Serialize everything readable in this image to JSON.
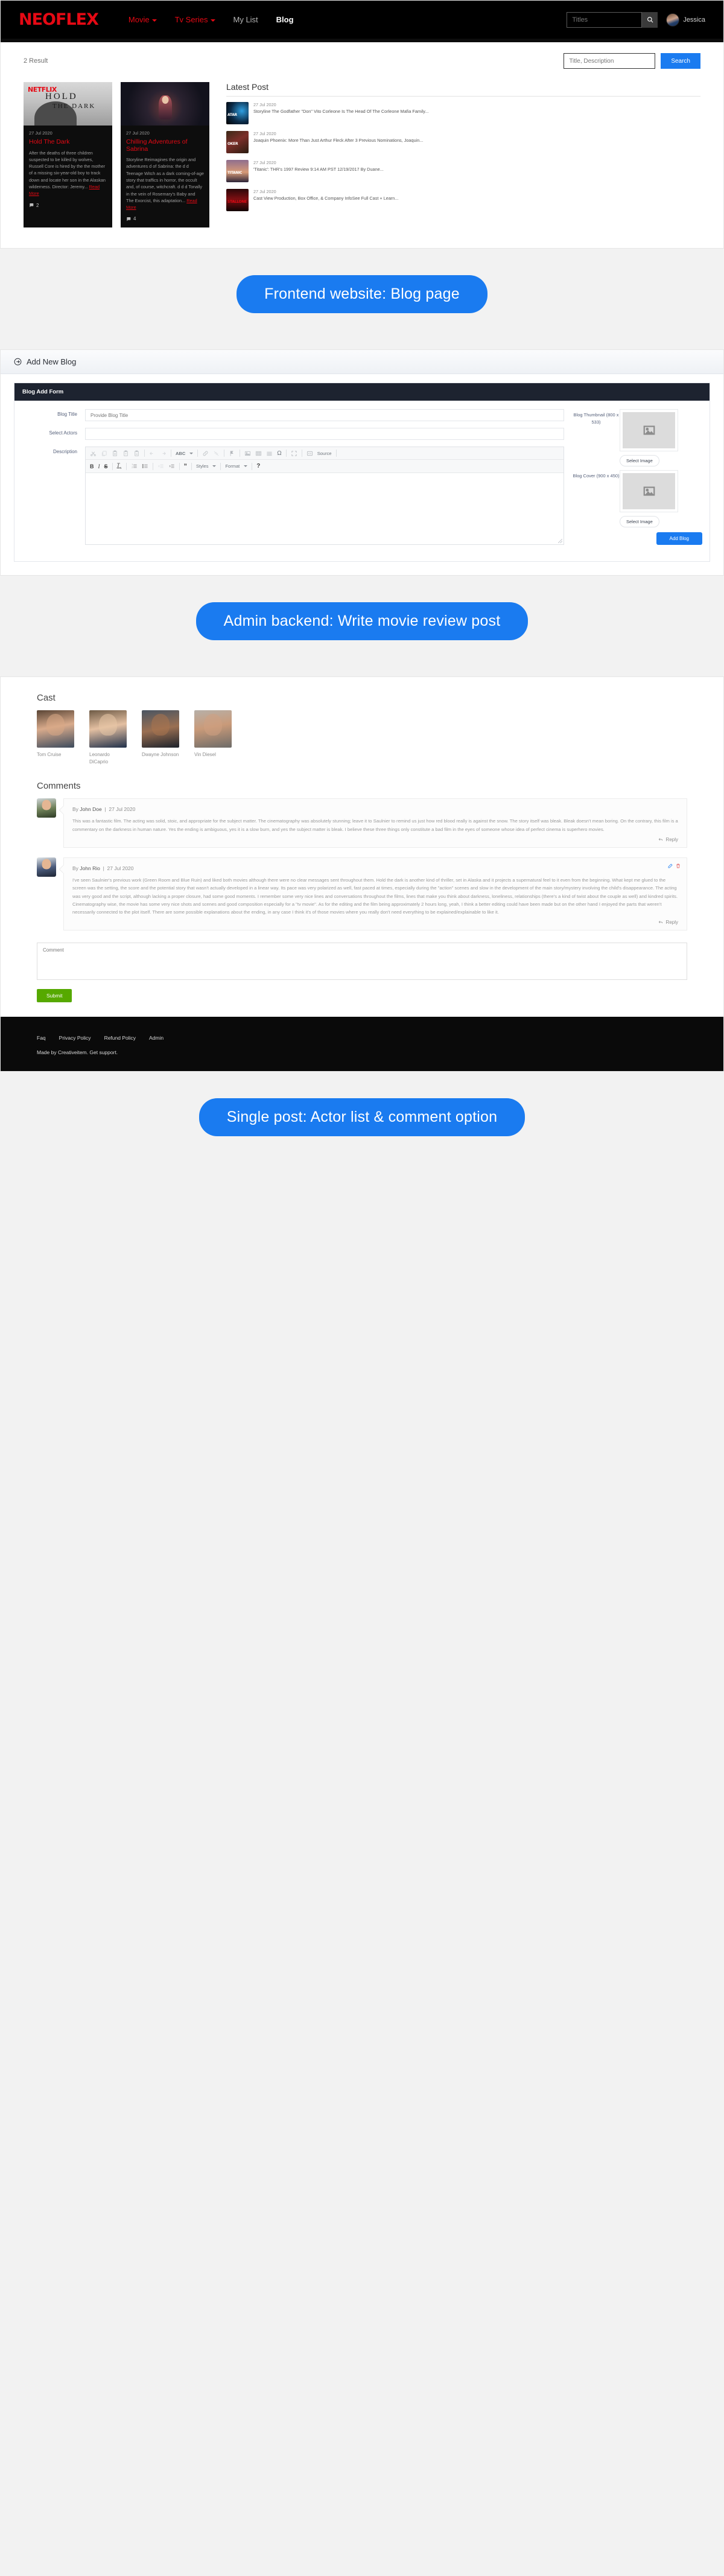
{
  "site": {
    "brand": "NEOFLEX",
    "nav": [
      {
        "label": "Movie",
        "style": "red",
        "caret": true
      },
      {
        "label": "Tv Series",
        "style": "red",
        "caret": true
      },
      {
        "label": "My List",
        "style": "muted",
        "caret": false
      },
      {
        "label": "Blog",
        "style": "active",
        "caret": false
      }
    ],
    "search_placeholder": "Titles",
    "search_icon": "search-icon",
    "user_name": "Jessica"
  },
  "blog": {
    "result_count": "2 Result",
    "filter_placeholder": "Title, Description",
    "search_button": "Search",
    "cards": [
      {
        "date": "27 Jul 2020",
        "title": "Hold The Dark",
        "excerpt": "After the deaths of three children suspected to be killed by wolves, Russell Core is hired by the the mother of a missing six-year-old boy to track down and locate her son in the Alaskan wilderness. Director:  Jeremy...",
        "read_more": "Read More",
        "comments": "2",
        "banner_logo": "NETFLIX",
        "banner_title": "HOLD",
        "banner_subtitle": "THE DARK"
      },
      {
        "date": "27 Jul 2020",
        "title": "Chilling Adventures of Sabrina",
        "excerpt": "Storyline Reimagines the origin and adventures d of Sabrina: the d d Teenage Witch as a dark coming-of-age story that traffics in horror, the occult and, of course, witchcraft. d d d Tonally in the vein of Rosemary's Baby and The Exorcist, this adaptation...",
        "read_more": "Read More",
        "comments": "4"
      }
    ],
    "latest_title": "Latest Post",
    "latest_posts": [
      {
        "date": "27 Jul 2020",
        "title": "Storyline The Godfather \"Don\" Vito Corleone Is The Head Of The Corleone Mafia Family...",
        "thumb": "avatar-mv",
        "thumb_text": "ATAR"
      },
      {
        "date": "27 Jul 2020",
        "title": "Joaquin Phoenix: More Than Just Arthur Fleck After 3 Previous Nominations, Joaquin...",
        "thumb": "joker",
        "thumb_text": "OKER"
      },
      {
        "date": "27 Jul 2020",
        "title": "'Titanic': THR's 1997 Review 9:14 AM PST 12/19/2017 By Duane...",
        "thumb": "titanic",
        "thumb_text": "TITANIC"
      },
      {
        "date": "27 Jul 2020",
        "title": "Cast View Production, Box Office, & Company InfoSee Full Cast + Learn...",
        "thumb": "stallone",
        "thumb_text": "STALLONE"
      }
    ]
  },
  "captions": {
    "one": "Frontend website: Blog page",
    "two": "Admin backend: Write movie review post",
    "three": "Single post: Actor list & comment option"
  },
  "admin": {
    "page_title": "Add New Blog",
    "page_icon": "arrow-circle-right-icon",
    "card_title": "Blog Add Form",
    "fields": [
      {
        "label": "Blog Title",
        "placeholder": "Provide Blog Title",
        "value": ""
      },
      {
        "label": "Select Actors",
        "placeholder": "",
        "value": ""
      }
    ],
    "description_label": "Description",
    "toolbar_row1": [
      {
        "name": "cut-icon",
        "glyph": "✂"
      },
      {
        "name": "copy-icon",
        "glyph": "❐"
      },
      {
        "name": "paste-icon",
        "glyph": "ὌB"
      },
      {
        "name": "paste-as-text-icon",
        "glyph": "T"
      },
      {
        "name": "paste-from-word-icon",
        "glyph": "W"
      },
      {
        "name": "undo-icon",
        "glyph": "↩"
      },
      {
        "name": "redo-icon",
        "glyph": "↪"
      },
      {
        "name": "spellcheck-icon",
        "glyph": "ABC"
      },
      {
        "name": "link-icon",
        "glyph": "ὑ7"
      },
      {
        "name": "unlink-icon",
        "glyph": "⛓"
      },
      {
        "name": "anchor-icon",
        "glyph": "⚑"
      },
      {
        "name": "image-icon",
        "glyph": "ὛC"
      },
      {
        "name": "table-icon",
        "glyph": "▦"
      },
      {
        "name": "horizontal-line-icon",
        "glyph": "☰"
      },
      {
        "name": "special-char-icon",
        "glyph": "Ω"
      },
      {
        "name": "maximize-icon",
        "glyph": "⤢"
      },
      {
        "name": "source-button",
        "glyph": "Source"
      }
    ],
    "toolbar_row2": [
      {
        "name": "bold-icon",
        "glyph": "B"
      },
      {
        "name": "italic-icon",
        "glyph": "I"
      },
      {
        "name": "strikethrough-icon",
        "glyph": "S"
      },
      {
        "name": "remove-format-icon",
        "glyph": "Tx"
      },
      {
        "name": "numbered-list-icon",
        "glyph": "≣"
      },
      {
        "name": "bulleted-list-icon",
        "glyph": "≡"
      },
      {
        "name": "decrease-indent-icon",
        "glyph": "←"
      },
      {
        "name": "increase-indent-icon",
        "glyph": "→"
      },
      {
        "name": "blockquote-icon",
        "glyph": "”"
      },
      {
        "name": "styles-dropdown",
        "glyph": "Styles"
      },
      {
        "name": "format-dropdown",
        "glyph": "Format"
      },
      {
        "name": "help-icon",
        "glyph": "?"
      }
    ],
    "styles_label": "Styles",
    "format_label": "Format",
    "thumbnail_label": "Blog Thumbnail (800 x 533)",
    "cover_label": "Blog Cover (900 x 450)",
    "select_image_label": "Select Image",
    "submit_label": "Add Blog",
    "accent": "#1a7bf0"
  },
  "post": {
    "cast_title": "Cast",
    "cast": [
      {
        "name": "Tom Cruise"
      },
      {
        "name": "Leonardo DiCaprio"
      },
      {
        "name": "Dwayne Johnson"
      },
      {
        "name": "Vin Diesel"
      }
    ],
    "comments_title": "Comments",
    "comments": [
      {
        "by_prefix": "By",
        "author": "John Doe",
        "separator": "|",
        "date": "27 Jul 2020",
        "body": "This was a fantastic film. The acting was solid, stoic, and appropriate for the subject matter. The cinematography was absolutely stunning; leave it to Saulnier to remind us just how red blood really is against the snow. The story itself was bleak. Bleak doesn't mean boring. On the contrary, this film is a commentary on the darkness in human nature. Yes the ending is ambiguous, yes it is a slow burn, and yes the subject matter is bleak. I believe these three things only constitute a bad film in the eyes of someone whose idea of perfect cinema is superhero movies.",
        "reply": "Reply",
        "has_actions": false
      },
      {
        "by_prefix": "By",
        "author": "John Rio",
        "separator": "|",
        "date": "27 Jul 2020",
        "body": "I've seen Saulnier's previous work (Green Room and Blue Ruin) and liked both movies although there were no clear messages sent throughout them. Hold the dark is another kind of thriller, set in Alaska and it projects a supernatural feel to it even from the beginning. What kept me glued to the screen was the setting, the score and the potential story that wasn't actually developed in a linear way. Its pace was very polarized as well, fast paced at times, especially during the \"action\" scenes and slow in the development of the main story/mystery involving the child's disappearance. The acting was very good and the script, although lacking a proper closure, had some good moments. I remember some very nice lines and conversations throughout the films, lines that make you think about darkness, loneliness, relationships (there's a kind of twist about the couple as well) and kindred spirits. Cinematography wise, the movie has some very nice shots and scenes and good composition especially for a \"tv movie\". As for the editing and the film being approximately 2 hours long, yeah, I think a better editing could have been made but on the other hand I enjoyed the parts that weren't necessarily connected to the plot itself. There are some possible explanations about the ending, in any case I think it's of those movies where you really don't need everything to be explained/explainable to like it.",
        "reply": "Reply",
        "has_actions": true,
        "edit_icon": "edit-icon",
        "delete_icon": "delete-icon"
      }
    ],
    "comment_placeholder": "Comment",
    "submit_label": "Submit"
  },
  "footer": {
    "links": [
      "Faq",
      "Privacy Policy",
      "Refund Policy",
      "Admin"
    ],
    "note": "Made by Creativeitem. Get support."
  }
}
